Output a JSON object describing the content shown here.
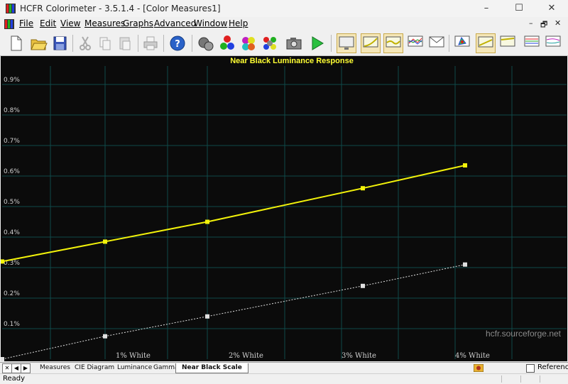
{
  "window": {
    "title": "HCFR Colorimeter - 3.5.1.4 - [Color Measures1]",
    "min_icon": "minimize-icon",
    "max_icon": "maximize-icon",
    "close_icon": "close-icon"
  },
  "menu": {
    "items": [
      {
        "label": "File"
      },
      {
        "label": "Edit"
      },
      {
        "label": "View"
      },
      {
        "label": "Measures"
      },
      {
        "label": "Graphs"
      },
      {
        "label": "Advanced"
      },
      {
        "label": "Window"
      },
      {
        "label": "Help"
      }
    ],
    "mdi_minimize": "–",
    "mdi_restore": "🗗",
    "mdi_close": "✕"
  },
  "toolbar": {
    "buttons": [
      "new",
      "open",
      "save",
      "cut",
      "copy",
      "paste",
      "print",
      "help",
      "sensor",
      "measure-rgb",
      "measure-gray",
      "measure-colors",
      "camera",
      "run",
      "graph-view",
      "graph-gamma",
      "graph-luminance",
      "graph-rgb",
      "graph-cie",
      "graph-near-black",
      "graph-near-white",
      "graph-saturation",
      "graph-saturation-shift"
    ]
  },
  "chart_data": {
    "type": "line",
    "title": "Near Black Luminance Response",
    "xlabel": "",
    "ylabel": "",
    "x_categories": [
      "1% White",
      "2% White",
      "3% White",
      "4% White"
    ],
    "xlim": [
      0,
      4
    ],
    "ylim": [
      0,
      1
    ],
    "y_tick_labels": [
      "0.1%",
      "0.2%",
      "0.3%",
      "0.4%",
      "0.5%",
      "0.6%",
      "0.7%",
      "0.8%",
      "0.9%"
    ],
    "y_ticks": [
      0.1,
      0.2,
      0.3,
      0.4,
      0.5,
      0.6,
      0.7,
      0.8,
      0.9
    ],
    "grid": true,
    "series": [
      {
        "points": [
          [
            0,
            0.32
          ],
          [
            1,
            0.385
          ],
          [
            2,
            0.45
          ],
          [
            3,
            0.56
          ],
          [
            4,
            0.635
          ]
        ],
        "color": "#f2f20a",
        "style": "solid"
      },
      {
        "points": [
          [
            0,
            0.0
          ],
          [
            1,
            0.075
          ],
          [
            2,
            0.14
          ],
          [
            3,
            0.24
          ],
          [
            4,
            0.31
          ]
        ],
        "color": "#e0e0e0",
        "style": "dotted"
      }
    ],
    "watermark": "hcfr.sourceforge.net"
  },
  "colors": {
    "chart_bg": "#0b0b0b",
    "grid": "#0f4a4a",
    "title": "#ffff33",
    "tick": "#d0d0d0",
    "series1": "#f2f20a",
    "series2": "#e0e0e0",
    "watermark": "#8a8a8a"
  },
  "tabs": {
    "items": [
      {
        "label": "Measures"
      },
      {
        "label": "CIE Diagram"
      },
      {
        "label": "Luminance"
      },
      {
        "label": "Gamma"
      },
      {
        "label": "Near Black Scale"
      }
    ],
    "active": "Near Black Scale",
    "reference_label": "Reference"
  },
  "status": {
    "text": "Ready"
  }
}
